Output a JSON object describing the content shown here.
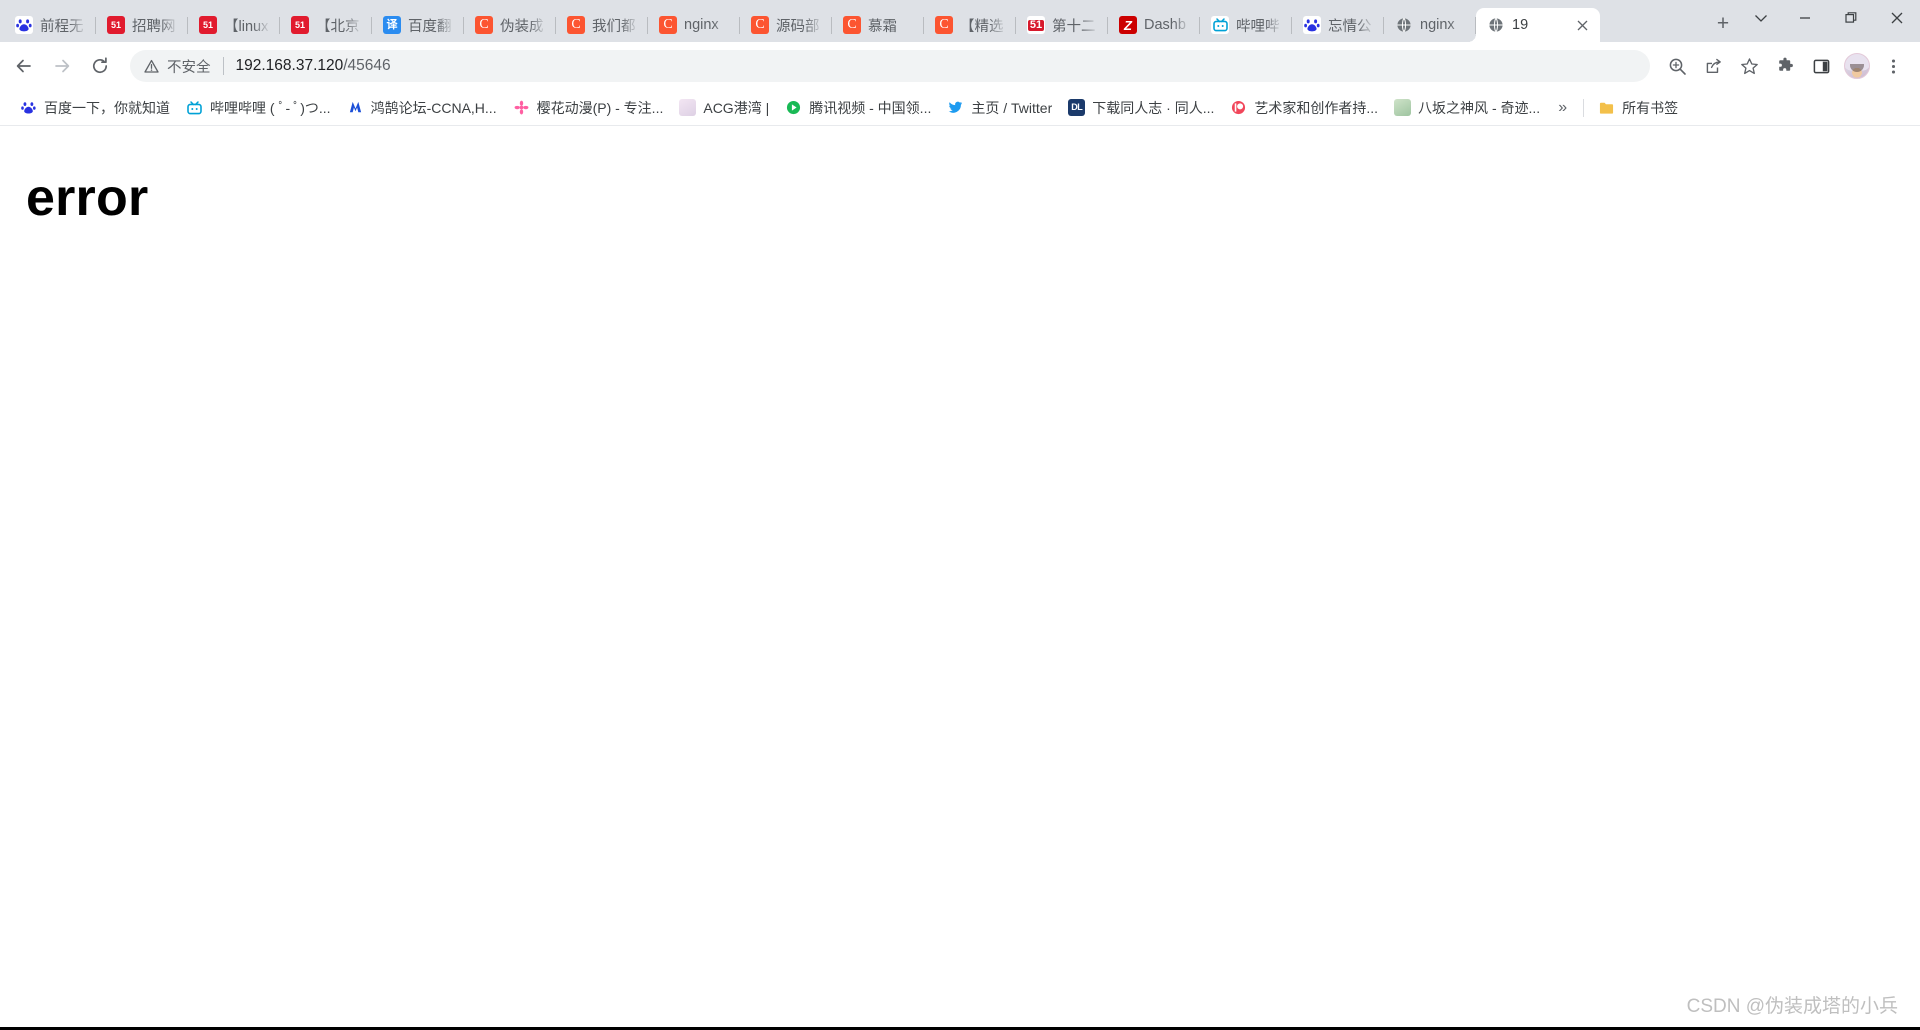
{
  "window": {
    "controls": [
      {
        "name": "tab-search-button",
        "glyph": "chevron-down"
      },
      {
        "name": "minimize-button",
        "glyph": "minimize"
      },
      {
        "name": "maximize-button",
        "glyph": "maximize"
      },
      {
        "name": "close-button",
        "glyph": "close"
      }
    ]
  },
  "tabs": [
    {
      "title": "前程无",
      "favicon": "baidu-icon",
      "favclass": "fav-baidu",
      "glyph": "百",
      "active": false
    },
    {
      "title": "招聘网",
      "favicon": "51job-icon",
      "favclass": "fav-zhaopin",
      "glyph": "51",
      "active": false
    },
    {
      "title": "【linux",
      "favicon": "51job-icon",
      "favclass": "fav-zhaopin",
      "glyph": "51",
      "active": false
    },
    {
      "title": "【北京",
      "favicon": "51job-icon",
      "favclass": "fav-zhaopin",
      "glyph": "51",
      "active": false
    },
    {
      "title": "百度翻",
      "favicon": "baidu-fanyi-icon",
      "favclass": "fav-fanyi",
      "glyph": "译",
      "active": false
    },
    {
      "title": "伪装成",
      "favicon": "csdn-icon",
      "favclass": "fav-csdn",
      "glyph": "C",
      "active": false
    },
    {
      "title": "我们都",
      "favicon": "csdn-icon",
      "favclass": "fav-csdn",
      "glyph": "C",
      "active": false
    },
    {
      "title": "nginx",
      "favicon": "csdn-icon",
      "favclass": "fav-csdn",
      "glyph": "C",
      "active": false
    },
    {
      "title": "源码部",
      "favicon": "csdn-icon",
      "favclass": "fav-csdn",
      "glyph": "C",
      "active": false
    },
    {
      "title": "慕霜",
      "favicon": "csdn-icon",
      "favclass": "fav-csdn",
      "glyph": "C",
      "active": false
    },
    {
      "title": "【精选",
      "favicon": "csdn-icon",
      "favclass": "fav-csdn",
      "glyph": "C",
      "active": false
    },
    {
      "title": "第十二",
      "favicon": "51cto-icon",
      "favclass": "fav-51",
      "glyph": "51",
      "active": false
    },
    {
      "title": "Dashb",
      "favicon": "zhihu-icon",
      "favclass": "fav-zhihu",
      "glyph": "Z",
      "active": false
    },
    {
      "title": "哔哩哔",
      "favicon": "bilibili-icon",
      "favclass": "fav-bili",
      "glyph": "□",
      "active": false
    },
    {
      "title": "忘情公",
      "favicon": "baidu-icon",
      "favclass": "fav-baidu",
      "glyph": "百",
      "active": false
    },
    {
      "title": "nginx",
      "favicon": "globe-icon",
      "favclass": "fav-globe",
      "glyph": "ἱ0",
      "active": false
    },
    {
      "title": "19",
      "favicon": "globe-icon",
      "favclass": "fav-globe",
      "glyph": "ἱ0",
      "active": true
    }
  ],
  "new_tab_button_label": "+",
  "toolbar": {
    "back_label": "back-arrow",
    "forward_label": "forward-arrow",
    "reload_label": "reload",
    "security_text": "不安全",
    "url_host": "192.168.37.120",
    "url_path": "/45646",
    "url_full": "192.168.37.120/45646",
    "icons": [
      {
        "name": "zoom-in-icon"
      },
      {
        "name": "share-icon"
      },
      {
        "name": "bookmark-star-icon"
      },
      {
        "name": "extensions-puzzle-icon"
      },
      {
        "name": "side-panel-icon"
      },
      {
        "name": "profile-avatar"
      },
      {
        "name": "browser-menu-icon"
      }
    ]
  },
  "bookmarks": [
    {
      "label": "百度一下，你就知道",
      "icoclass": "bm-baidu",
      "glyph": "百",
      "name": "bookmark-baidu"
    },
    {
      "label": "哔哩哔哩 ( ﾟ- ﾟ)つ...",
      "icoclass": "bm-bili",
      "glyph": "□",
      "name": "bookmark-bilibili"
    },
    {
      "label": "鸿鹄论坛-CCNA,H...",
      "icoclass": "bm-hq",
      "glyph": "❇",
      "name": "bookmark-honghu"
    },
    {
      "label": "樱花动漫(P) - 专注...",
      "icoclass": "bm-sakura",
      "glyph": "✿",
      "name": "bookmark-sakura"
    },
    {
      "label": "ACG港湾 |",
      "icoclass": "bm-acg",
      "glyph": "",
      "name": "bookmark-acg"
    },
    {
      "label": "腾讯视频 - 中国领...",
      "icoclass": "bm-tx",
      "glyph": "▶",
      "name": "bookmark-tencent-video"
    },
    {
      "label": "主页 / Twitter",
      "icoclass": "bm-tw",
      "glyph": "✉",
      "name": "bookmark-twitter"
    },
    {
      "label": "下载同人志 · 同人...",
      "icoclass": "bm-dl",
      "glyph": "DL",
      "name": "bookmark-doujin"
    },
    {
      "label": "艺术家和创作者持...",
      "icoclass": "bm-patreon",
      "glyph": "ⓟ",
      "name": "bookmark-patreon"
    },
    {
      "label": "八坂之神风 - 奇迹...",
      "icoclass": "bm-ys",
      "glyph": "",
      "name": "bookmark-yasaka"
    }
  ],
  "bookmarks_overflow_label": "»",
  "all_bookmarks": {
    "label": "所有书签",
    "icoclass": "bm-folder",
    "glyph": "▮"
  },
  "page": {
    "heading": "error",
    "watermark": "CSDN @伪装成塔的小兵"
  }
}
